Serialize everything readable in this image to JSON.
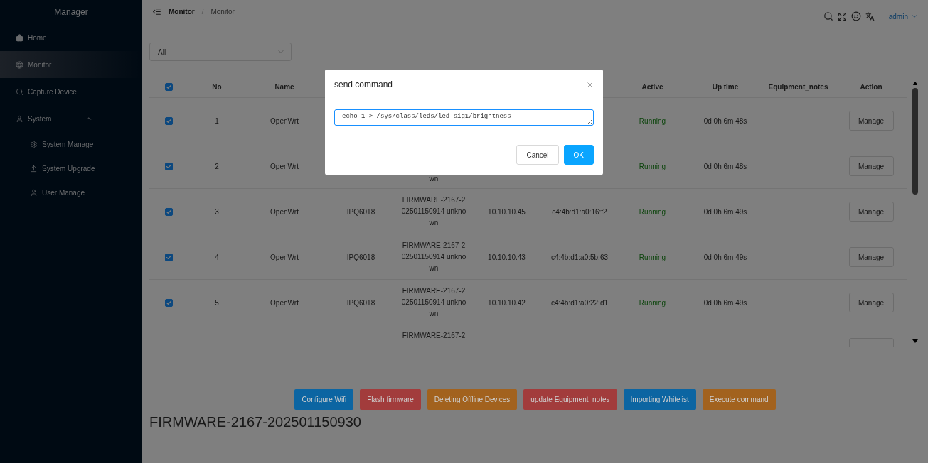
{
  "sidebar": {
    "title": "Manager",
    "items": [
      {
        "label": "Home",
        "selected": false
      },
      {
        "label": "Monitor",
        "selected": true
      },
      {
        "label": "Capture Device",
        "selected": false
      },
      {
        "label": "System",
        "selected": false,
        "expanded": true,
        "children": [
          {
            "label": "System Manage",
            "selected": false
          },
          {
            "label": "System Upgrade",
            "selected": false
          },
          {
            "label": "User Manage",
            "selected": false
          }
        ]
      }
    ]
  },
  "breadcrumb": [
    "Monitor",
    "Monitor"
  ],
  "breadcrumb_separator": "/",
  "user": "admin",
  "filter": {
    "value": "All"
  },
  "table": {
    "header": {
      "select_all_checked": true,
      "no": "No",
      "name": "Name",
      "active": "Active",
      "uptime": "Up time",
      "notes": "Equipment_notes",
      "action": "Action"
    },
    "rows": [
      {
        "checked": true,
        "no": "1",
        "name": "OpenWrt",
        "active": "Running",
        "uptime": "0d 0h 6m 48s",
        "action": "Manage"
      },
      {
        "checked": true,
        "no": "2",
        "name": "OpenWrt",
        "firmware": [
          "wn"
        ],
        "active": "Running",
        "uptime": "0d 0h 6m 48s",
        "action": "Manage"
      },
      {
        "checked": true,
        "no": "3",
        "name": "OpenWrt",
        "model": "IPQ6018",
        "firmware": [
          "FIRMWARE-2167-2",
          "02501150914 unkno",
          "wn"
        ],
        "ip": "10.10.10.45",
        "mac": "c4:4b:d1:a0:16:f2",
        "active": "Running",
        "uptime": "0d 0h 6m 49s",
        "action": "Manage"
      },
      {
        "checked": true,
        "no": "4",
        "name": "OpenWrt",
        "model": "IPQ6018",
        "firmware": [
          "FIRMWARE-2167-2",
          "02501150914 unkno",
          "wn"
        ],
        "ip": "10.10.10.43",
        "mac": "c4:4b:d1:a0:5b:63",
        "active": "Running",
        "uptime": "0d 0h 6m 49s",
        "action": "Manage"
      },
      {
        "checked": true,
        "no": "5",
        "name": "OpenWrt",
        "model": "IPQ6018",
        "firmware": [
          "FIRMWARE-2167-2",
          "02501150914 unkno",
          "wn"
        ],
        "ip": "10.10.10.42",
        "mac": "c4:4b:d1:a0:22:d1",
        "active": "Running",
        "uptime": "0d 0h 6m 49s",
        "action": "Manage"
      },
      {
        "firmware": [
          "FIRMWARE-2167-2"
        ],
        "action_button": true
      }
    ]
  },
  "actions": [
    {
      "label": "Configure Wifi",
      "color": "#0c65a2"
    },
    {
      "label": "Flash firmware",
      "color": "#a23c3c"
    },
    {
      "label": "Deleting Offline Devices",
      "color": "#a2621e"
    },
    {
      "label": "update Equipment_notes",
      "color": "#a23c3c"
    },
    {
      "label": "Importing Whitelist",
      "color": "#0c65a2"
    },
    {
      "label": "Execute command",
      "color": "#a2621e"
    }
  ],
  "firmware_version": "FIRMWARE-2167-202501150930",
  "dialog": {
    "title": "send command",
    "command": "echo 1 > /sys/class/leds/led-sig1/brightness",
    "buttons": [
      {
        "label": "Cancel",
        "kind": "default"
      },
      {
        "label": "OK",
        "kind": "primary"
      }
    ]
  }
}
